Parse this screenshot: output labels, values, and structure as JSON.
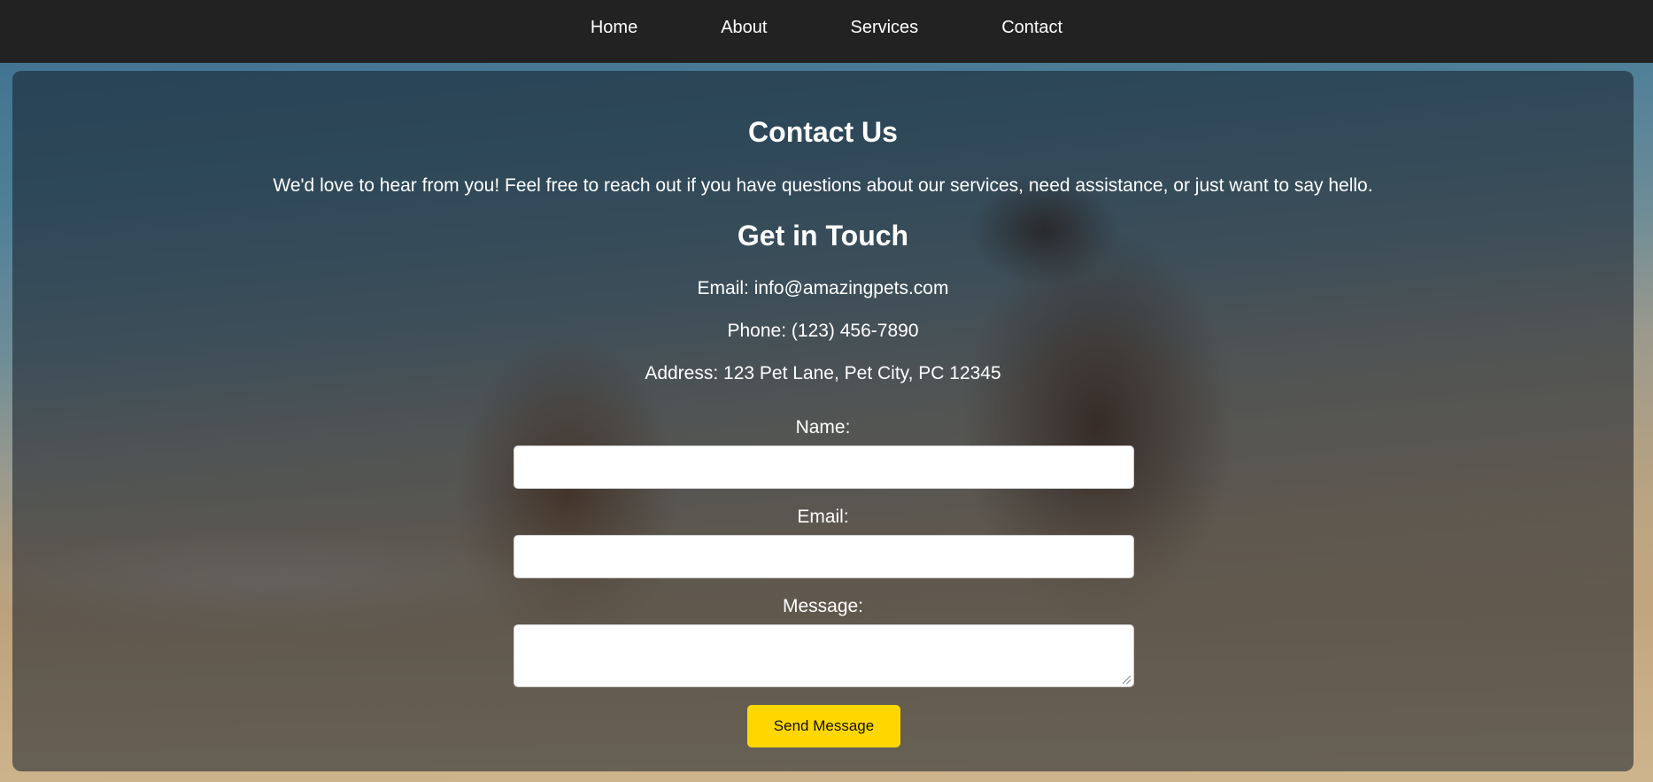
{
  "nav": {
    "items": [
      {
        "label": "Home"
      },
      {
        "label": "About"
      },
      {
        "label": "Services"
      },
      {
        "label": "Contact"
      }
    ]
  },
  "contact": {
    "title": "Contact Us",
    "intro": "We'd love to hear from you! Feel free to reach out if you have questions about our services, need assistance, or just want to say hello.",
    "subtitle": "Get in Touch",
    "email_line": "Email: info@amazingpets.com",
    "phone_line": "Phone: (123) 456-7890",
    "address_line": "Address: 123 Pet Lane, Pet City, PC 12345"
  },
  "form": {
    "name_label": "Name:",
    "name_value": "",
    "email_label": "Email:",
    "email_value": "",
    "message_label": "Message:",
    "message_value": "",
    "submit_label": "Send Message"
  },
  "colors": {
    "nav_bg": "#222222",
    "accent_button": "#ffd700",
    "text": "#ffffff"
  }
}
